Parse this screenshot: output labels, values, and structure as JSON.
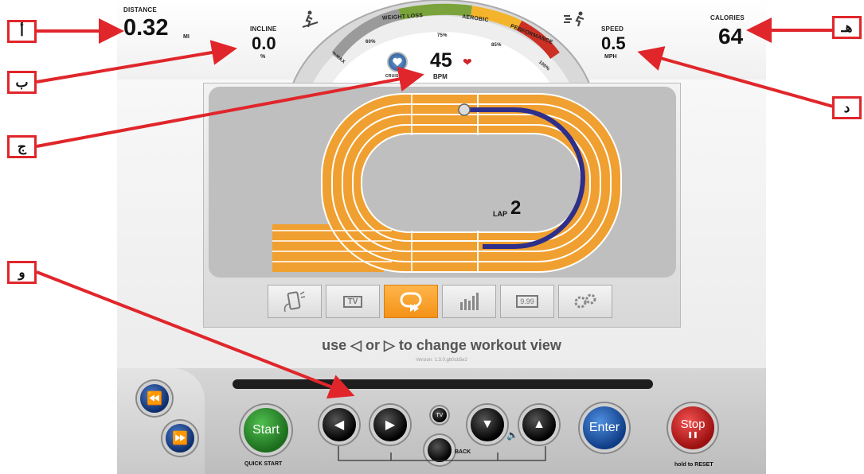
{
  "metrics": {
    "distance": {
      "label": "DISTANCE",
      "value": "0.32",
      "unit": "MI"
    },
    "incline": {
      "label": "INCLINE",
      "value": "0.0",
      "unit": "%"
    },
    "speed": {
      "label": "SPEED",
      "value": "0.5",
      "unit": "MPH"
    },
    "calories": {
      "label": "CALORIES",
      "value": "64"
    },
    "heart_rate": {
      "value": "45",
      "unit": "BPM"
    }
  },
  "gauge": {
    "zones": [
      "WEIGHT LOSS",
      "AEROBIC",
      "PERFORMANCE"
    ],
    "ticks": [
      "%MAX",
      "60%",
      "75%",
      "85%",
      "100%"
    ],
    "cruise_label": "CRUISE"
  },
  "track": {
    "lap_label": "LAP",
    "lap_value": "2"
  },
  "modes": [
    {
      "icon": "phone-icon"
    },
    {
      "icon": "tv-icon",
      "text": "TV"
    },
    {
      "icon": "track-view-icon",
      "active": true
    },
    {
      "icon": "bar-chart-icon"
    },
    {
      "icon": "display-value-icon",
      "text": "9.99"
    },
    {
      "icon": "gears-icon"
    }
  ],
  "hint": {
    "prefix": "use",
    "middle": "or",
    "suffix": "to change workout view"
  },
  "version": "Version: 1.3.0.gb0cb5e2",
  "controls": {
    "start": "Start",
    "quick_start": "QUICK START",
    "back": "BACK",
    "tv": "TV",
    "enter": "Enter",
    "stop": "Stop",
    "stop_hint": "hold to RESET"
  },
  "callouts": [
    "أ",
    "ب",
    "ج",
    "و",
    "هـ",
    "د"
  ],
  "colors": {
    "callout_red": "#e0262b",
    "track_orange": "#f0a030",
    "lane_blue": "#2e2f8a",
    "start_green": "#2f8f2f",
    "enter_blue": "#1f5fb0",
    "stop_red": "#d22a2a"
  }
}
